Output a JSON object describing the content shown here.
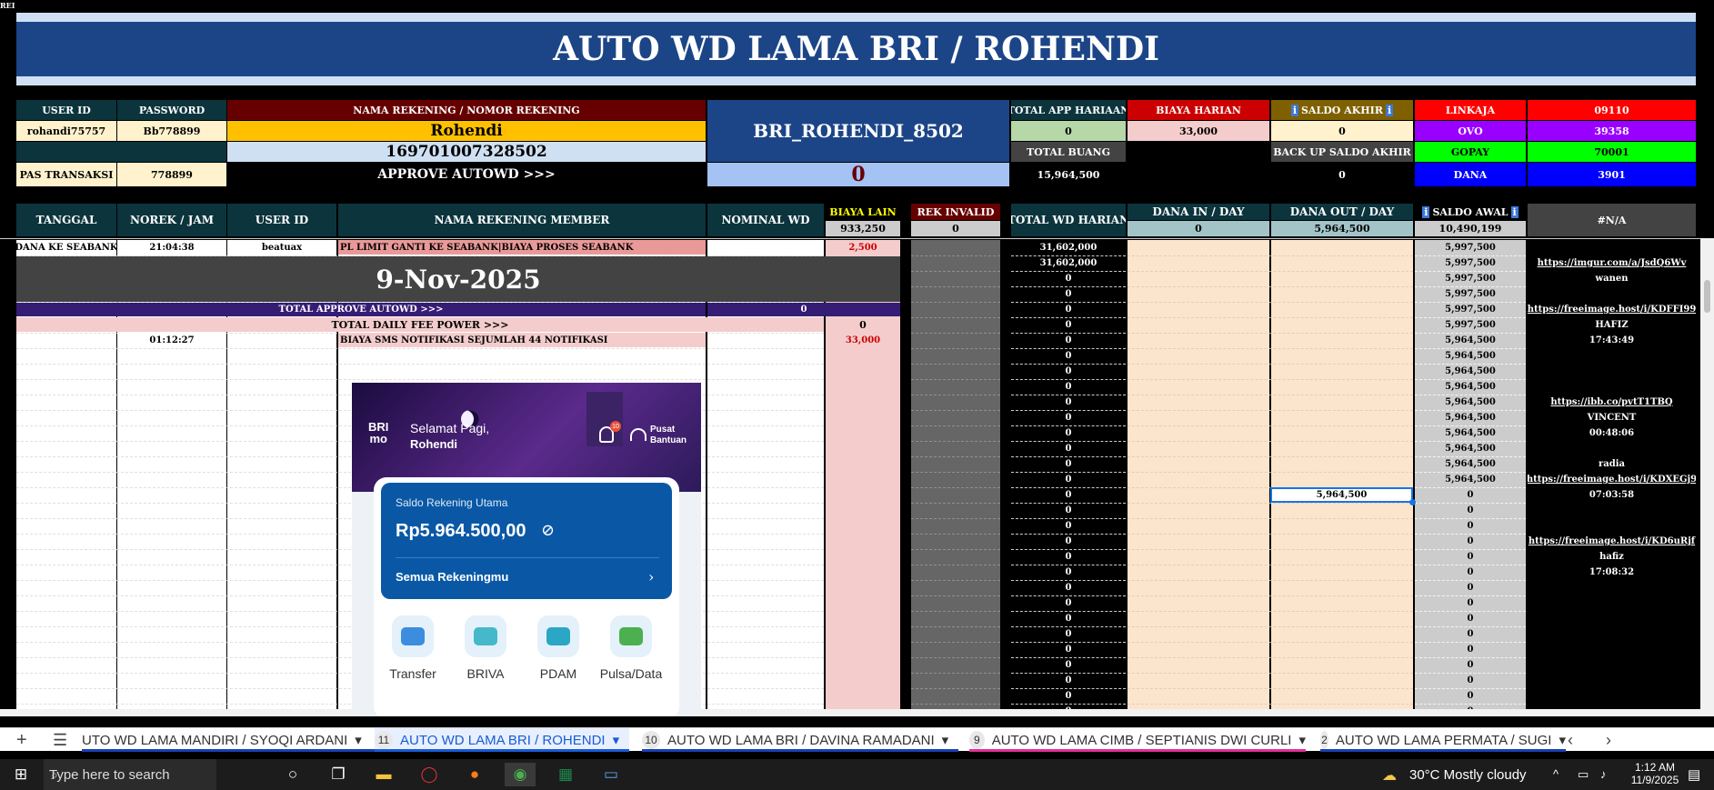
{
  "sheet": {
    "title": "AUTO WD LAMA BRI / ROHENDI",
    "corner": "REI",
    "header_labels": {
      "user_id": "USER ID",
      "password": "PASSWORD",
      "nama_rek": "NAMA REKENING / NOMOR REKENING",
      "pas_transaksi": "PAS TRANSAKSI",
      "approve": "APPROVE AUTOWD >>>"
    },
    "user_id": "rohandi75757",
    "password": "Bb778899",
    "nama": "Rohendi",
    "nomor": "169701007328502",
    "pas": "778899",
    "account_code": "BRI_ROHENDI_8502",
    "approve_value": "0",
    "stats": {
      "total_app_label": "TOTAL APP HARIAAN",
      "total_app_value": "0",
      "biaya_label": "BIAYA HARIAN",
      "biaya_value": "33,000",
      "saldo_akhir_label": "SALDO AKHIR",
      "saldo_akhir_value": "0",
      "total_buang_label": "TOTAL BUANG",
      "total_buang_value": "15,964,500",
      "backup_label": "BACK UP SALDO AKHIR",
      "backup_value": "0"
    },
    "wallets": [
      {
        "name": "LINKAJA",
        "value": "09110",
        "color": "#ff0000"
      },
      {
        "name": "OVO",
        "value": "39358",
        "color": "#9900ff"
      },
      {
        "name": "GOPAY",
        "value": "70001",
        "color": "#00ff00"
      },
      {
        "name": "DANA",
        "value": "3901",
        "color": "#0000ff"
      }
    ],
    "columns": {
      "tanggal": "TANGGAL",
      "norek": "NOREK / JAM",
      "user": "USER ID",
      "nama_member": "NAMA REKENING MEMBER",
      "nominal": "NOMINAL WD",
      "biaya_lain": "BIAYA LAIN",
      "biaya_lain_val": "933,250",
      "rek_invalid": "REK INVALID",
      "rek_invalid_val": "0",
      "total_wd": "TOTAL WD HARIAN",
      "dana_in": "DANA IN / DAY",
      "dana_in_val": "0",
      "dana_out": "DANA OUT / DAY",
      "dana_out_val": "5,964,500",
      "saldo_awal": "SALDO AWAL",
      "saldo_awal_val": "10,490,199",
      "na": "#N/A"
    },
    "row1": {
      "tanggal": "DANA KE SEABANK",
      "jam": "21:04:38",
      "user": "beatuax",
      "nama": "PL LIMIT GANTI KE SEABANK|BIAYA PROSES SEABANK",
      "biaya": "2,500"
    },
    "date_label": "9-Nov-2025",
    "total_approve_label": "TOTAL APPROVE AUTOWD >>>",
    "total_approve_value": "0",
    "total_fee_label": "TOTAL DAILY FEE POWER >>>",
    "total_fee_value": "0",
    "row_sms": {
      "jam": "01:12:27",
      "nama": "BIAYA SMS NOTIFIKASI SEJUMLAH 44 NOTIFIKASI",
      "biaya": "33,000"
    },
    "total_wd": [
      "31,602,000",
      "31,602,000",
      "0",
      "0",
      "0",
      "0",
      "0",
      "0",
      "0",
      "0",
      "0",
      "0",
      "0",
      "0",
      "0",
      "0",
      "0",
      "0",
      "0",
      "0",
      "0",
      "0",
      "0",
      "0",
      "0",
      "0",
      "0",
      "0",
      "0",
      "0",
      "0",
      "0"
    ],
    "saldo_awal": [
      "5,997,500",
      "5,997,500",
      "5,997,500",
      "5,997,500",
      "5,997,500",
      "5,997,500",
      "5,964,500",
      "5,964,500",
      "5,964,500",
      "5,964,500",
      "5,964,500",
      "5,964,500",
      "5,964,500",
      "5,964,500",
      "5,964,500",
      "5,964,500",
      "0",
      "0",
      "0",
      "0",
      "0",
      "0",
      "0",
      "0",
      "0",
      "0",
      "0",
      "0",
      "0",
      "0",
      "0",
      "0"
    ],
    "dana_out_cell": "5,964,500",
    "notes": [
      {
        "row": 1,
        "text": "https://imgur.com/a/JsdQ6Wv",
        "link": true
      },
      {
        "row": 2,
        "text": "wanen",
        "link": false
      },
      {
        "row": 4,
        "text": "https://freeimage.host/i/KDFFI99",
        "link": true
      },
      {
        "row": 5,
        "text": "HAFIZ",
        "link": false
      },
      {
        "row": 6,
        "text": "17:43:49",
        "link": false
      },
      {
        "row": 10,
        "text": "https://ibb.co/pvtT1TBQ",
        "link": true
      },
      {
        "row": 11,
        "text": "VINCENT",
        "link": false
      },
      {
        "row": 12,
        "text": "00:48:06",
        "link": false
      },
      {
        "row": 14,
        "text": "radia",
        "link": false
      },
      {
        "row": 15,
        "text": "https://freeimage.host/i/KDXEGj9",
        "link": true
      },
      {
        "row": 16,
        "text": "07:03:58",
        "link": false
      },
      {
        "row": 19,
        "text": "https://freeimage.host/i/KD6uRjf",
        "link": true
      },
      {
        "row": 20,
        "text": "hafiz",
        "link": false
      },
      {
        "row": 21,
        "text": "17:08:32",
        "link": false
      }
    ]
  },
  "phone": {
    "greeting": "Selamat Pagi,",
    "name": "Rohendi",
    "help": "Pusat Bantuan",
    "logo_top": "BRI",
    "logo_bottom": "mo",
    "badge": "10",
    "card_label": "Saldo Rekening Utama",
    "balance": "Rp5.964.500,00",
    "all_accounts": "Semua Rekeningmu",
    "menu": [
      "Transfer",
      "BRIVA",
      "PDAM",
      "Pulsa/Data"
    ]
  },
  "tabs": [
    {
      "label": "UTO WD LAMA MANDIRI / SYOQI ARDANI",
      "num": "",
      "color": "#1a3fb3"
    },
    {
      "label": "AUTO WD LAMA BRI / ROHENDI",
      "num": "11",
      "color": "#1a5bd6",
      "active": true
    },
    {
      "label": "AUTO WD LAMA BRI / DAVINA  RAMADANI",
      "num": "10",
      "color": "#1a3fb3"
    },
    {
      "label": "AUTO WD LAMA CIMB / SEPTIANIS DWI CURLI",
      "num": "9",
      "color": "#e0309a"
    },
    {
      "label": "AUTO WD LAMA PERMATA / SUGI",
      "num": "2",
      "color": "#1a3fb3"
    }
  ],
  "taskbar": {
    "search": "Type here to search",
    "weather": "30°C  Mostly cloudy",
    "time": "1:12 AM",
    "date": "11/9/2025"
  }
}
